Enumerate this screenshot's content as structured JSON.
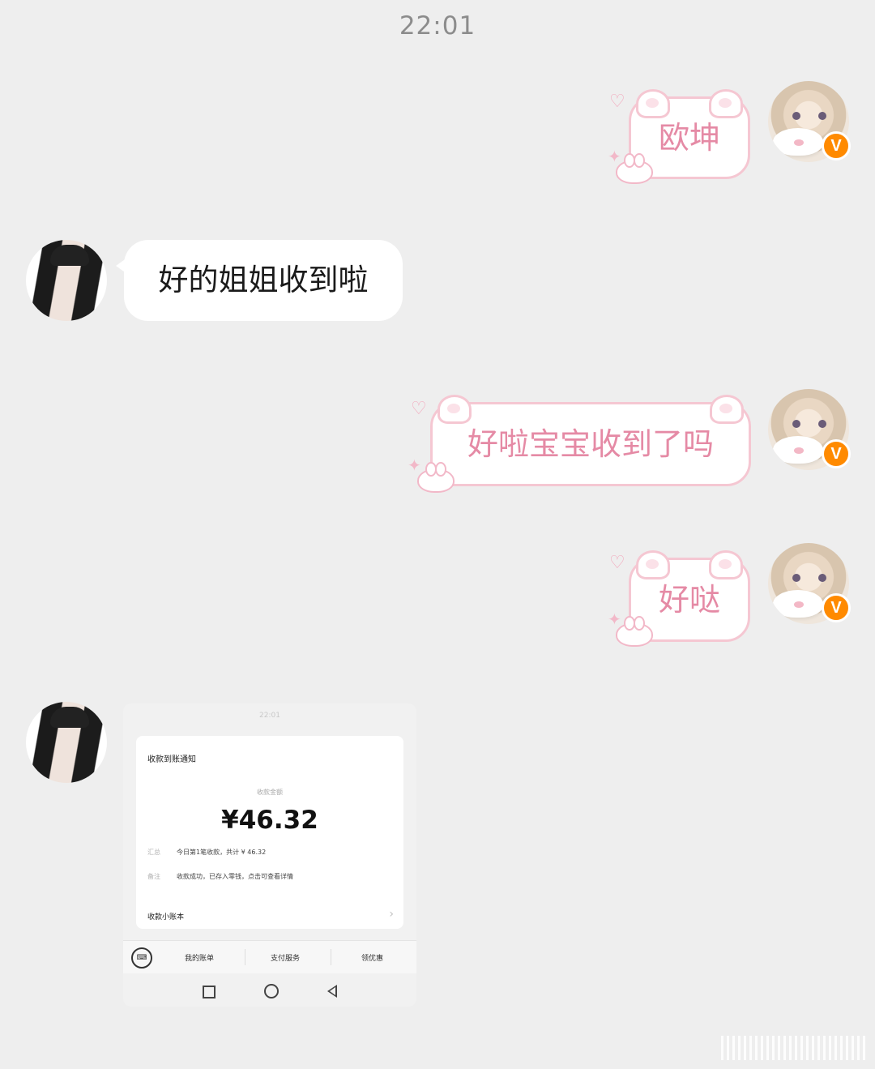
{
  "header": {
    "time": "22:01"
  },
  "colors": {
    "bubble_pink_border": "#f5c7d2",
    "bubble_pink_text": "#e58aa5",
    "badge": "#ff8a00",
    "background": "#eeeeee"
  },
  "messages": [
    {
      "sender": "self",
      "text": "欧坤"
    },
    {
      "sender": "other",
      "text": "好的姐姐收到啦"
    },
    {
      "sender": "self",
      "text": "好啦宝宝收到了吗"
    },
    {
      "sender": "self",
      "text": "好哒"
    },
    {
      "sender": "other",
      "type": "image"
    }
  ],
  "badge_label": "V",
  "payment_shot": {
    "time": "22:01",
    "card_title": "收款到账通知",
    "amount_label": "收款金额",
    "amount": "¥46.32",
    "summary_key": "汇总",
    "summary_value": "今日第1笔收款，共计 ¥ 46.32",
    "note_key": "备注",
    "note_value": "收款成功，已存入零钱，点击可查看详情",
    "ledger": "收款小账本",
    "menu": [
      "我的账单",
      "支付服务",
      "领优惠"
    ]
  }
}
